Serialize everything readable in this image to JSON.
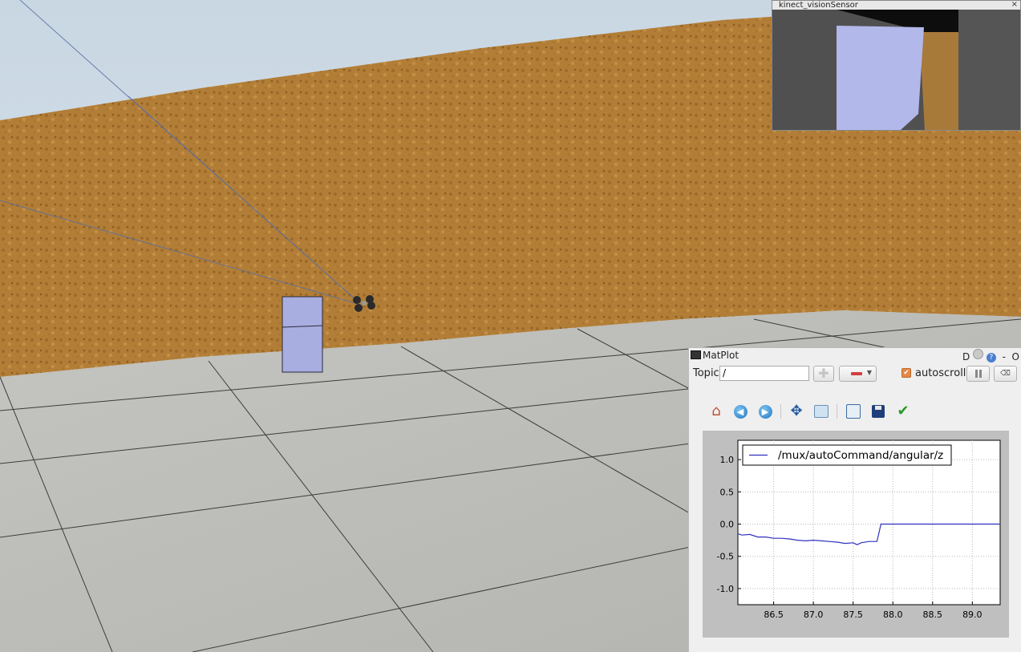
{
  "vision_window": {
    "title": "kinect_visionSensor",
    "close_label": "×"
  },
  "matplot": {
    "title": "MatPlot",
    "title_buttons": {
      "d_label": "D",
      "help_label": "?",
      "minimize_label": "-",
      "close_label": "O"
    },
    "topic_label": "Topic",
    "topic_value": "/",
    "autoscroll_label": "autoscroll",
    "autoscroll_checked": true,
    "toolbar_icons": [
      "home-icon",
      "back-icon",
      "forward-icon",
      "pan-icon",
      "zoom-icon",
      "configure-subplots-icon",
      "save-icon",
      "edit-axis-icon"
    ]
  },
  "chart_data": {
    "type": "line",
    "legend": "/mux/autoCommand/angular/z",
    "legend_position": "top-left",
    "grid": true,
    "xlim": [
      86.05,
      89.35
    ],
    "ylim": [
      -1.25,
      1.3
    ],
    "xticks": [
      "86.5",
      "87.0",
      "87.5",
      "88.0",
      "88.5",
      "89.0"
    ],
    "yticks": [
      "1.0",
      "0.5",
      "0.0",
      "-0.5",
      "-1.0"
    ],
    "series": [
      {
        "name": "/mux/autoCommand/angular/z",
        "color": "#3030c0",
        "x": [
          86.05,
          86.1,
          86.2,
          86.3,
          86.4,
          86.5,
          86.6,
          86.7,
          86.8,
          86.9,
          87.0,
          87.1,
          87.2,
          87.3,
          87.4,
          87.5,
          87.55,
          87.6,
          87.7,
          87.75,
          87.8,
          87.85,
          88.0,
          88.5,
          89.0,
          89.35
        ],
        "y": [
          -0.15,
          -0.17,
          -0.16,
          -0.2,
          -0.2,
          -0.22,
          -0.22,
          -0.23,
          -0.25,
          -0.26,
          -0.25,
          -0.26,
          -0.27,
          -0.28,
          -0.3,
          -0.29,
          -0.32,
          -0.29,
          -0.27,
          -0.27,
          -0.27,
          0.0,
          0.0,
          0.0,
          0.0,
          0.0
        ]
      }
    ]
  }
}
